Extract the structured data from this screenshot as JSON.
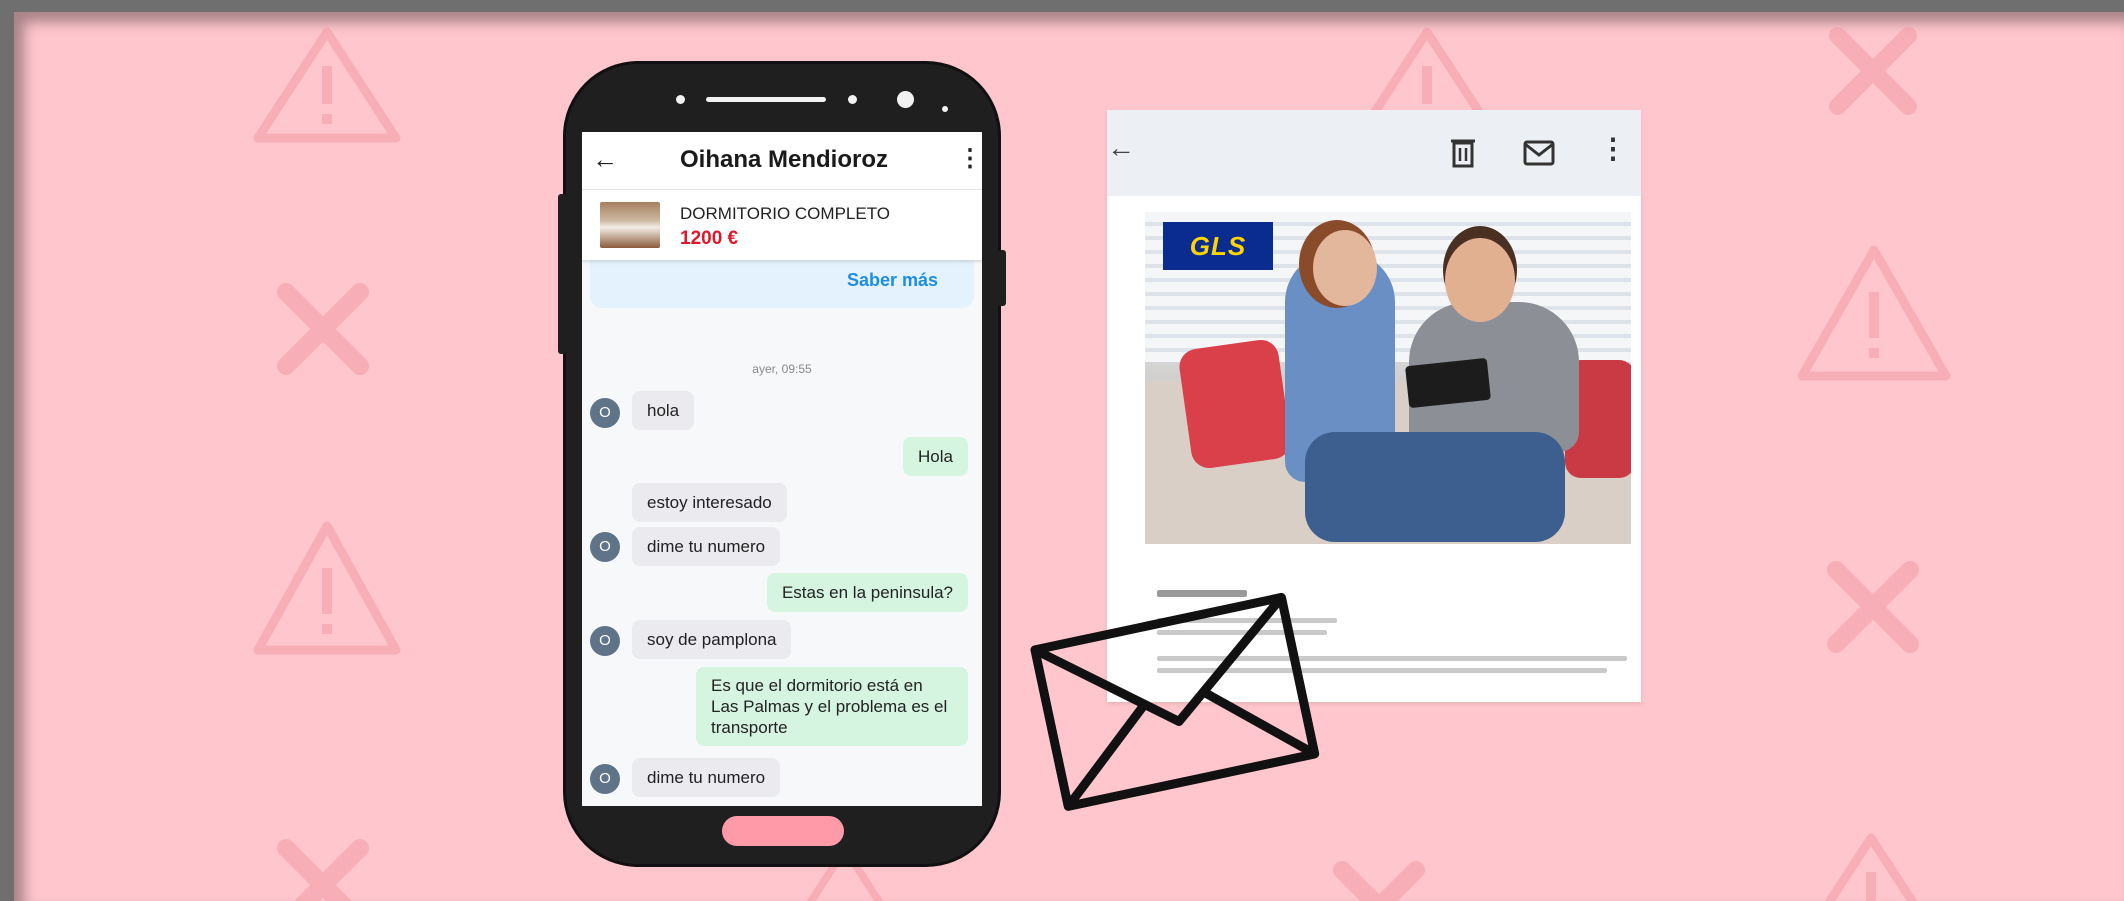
{
  "chat": {
    "contact_name": "Oihana Mendioroz",
    "back_icon": "arrow-left-icon",
    "menu_icon": "more-vertical-icon",
    "product": {
      "title": "DORMITORIO COMPLETO",
      "price": "1200 €"
    },
    "promo_link": "Saber más",
    "timestamp": "ayer, 09:55",
    "avatar_initial": "O",
    "messages": [
      {
        "side": "in",
        "text": "hola"
      },
      {
        "side": "out",
        "text": "Hola"
      },
      {
        "side": "in",
        "text": "estoy interesado"
      },
      {
        "side": "in",
        "text": "dime tu numero"
      },
      {
        "side": "out",
        "text": "Estas en la peninsula?"
      },
      {
        "side": "in",
        "text": "soy de pamplona"
      },
      {
        "side": "out",
        "text": "Es que el dormitorio está en Las Palmas y el problema es el transporte"
      },
      {
        "side": "in",
        "text": "dime tu numero"
      }
    ]
  },
  "email": {
    "logo_text": "GLS",
    "toolbar_icons": [
      "arrow-left-icon",
      "trash-icon",
      "mail-icon",
      "more-vertical-icon"
    ]
  },
  "colors": {
    "background": "#ffc7cd",
    "price_red": "#e0172a",
    "link_blue": "#1f8ee0",
    "outgoing_bubble": "#d6f5e1",
    "incoming_bubble": "#eaeaef"
  }
}
